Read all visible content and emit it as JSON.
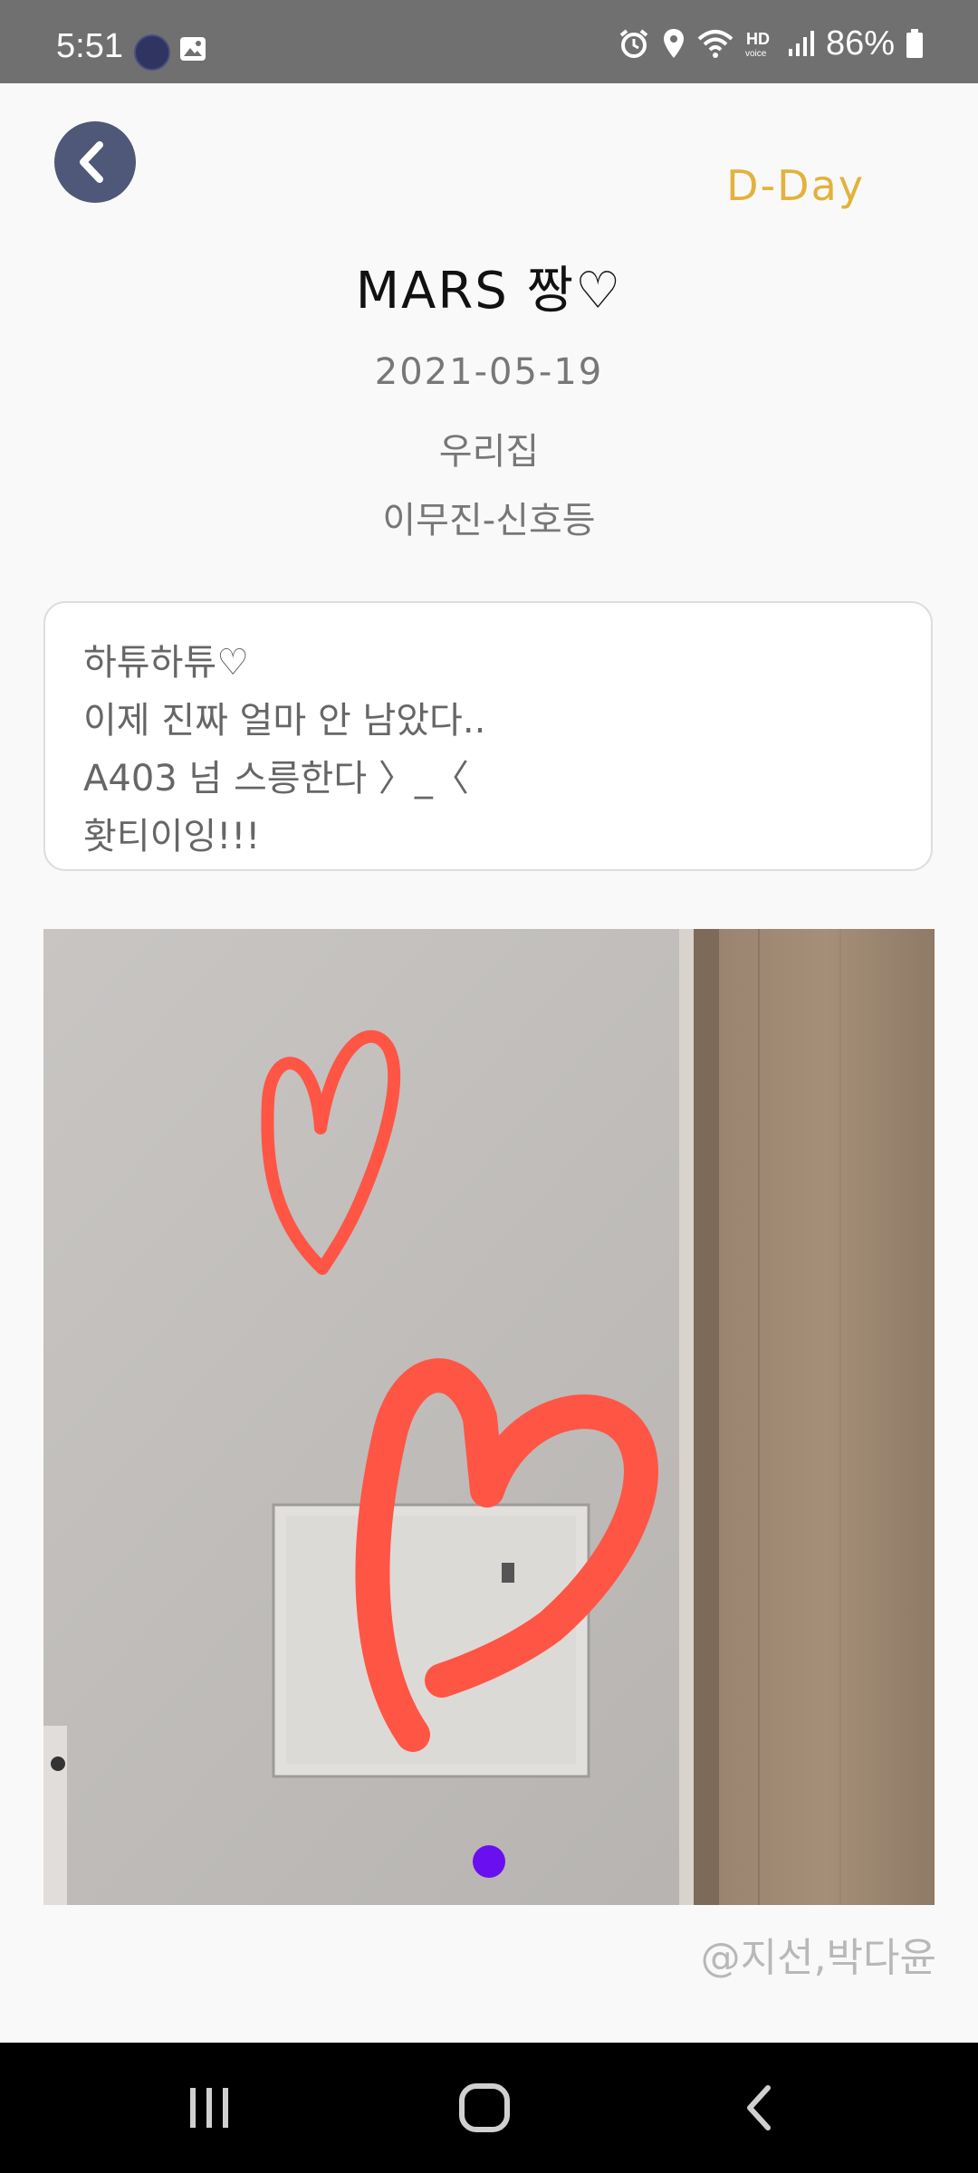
{
  "status_bar": {
    "time": "5:51",
    "battery": "86%",
    "icons": [
      "app-icon",
      "gallery-icon",
      "alarm-icon",
      "location-icon",
      "wifi-icon",
      "hd-voice-icon",
      "signal-icon",
      "battery-icon"
    ]
  },
  "header": {
    "back_icon": "chevron-left-icon",
    "dday_label": "D-Day",
    "accent_color": "#e3b23c"
  },
  "post": {
    "title": "MARS 짱♡",
    "date": "2021-05-19",
    "place": "우리집",
    "people": "이무진-신호등",
    "memo_lines": [
      "하튜하튜♡",
      "이제 진짜 얼마 안 남았다..",
      "A403 넘 스릉한다 〉_〈",
      "홧티이잉!!!"
    ]
  },
  "photo": {
    "page_indicator_color": "#6a0ff0",
    "page_count": 1,
    "current_page": 1
  },
  "credit": "@지선,박다윤",
  "nav_bar": {
    "buttons": [
      "recent-apps-icon",
      "home-icon",
      "back-icon"
    ]
  }
}
